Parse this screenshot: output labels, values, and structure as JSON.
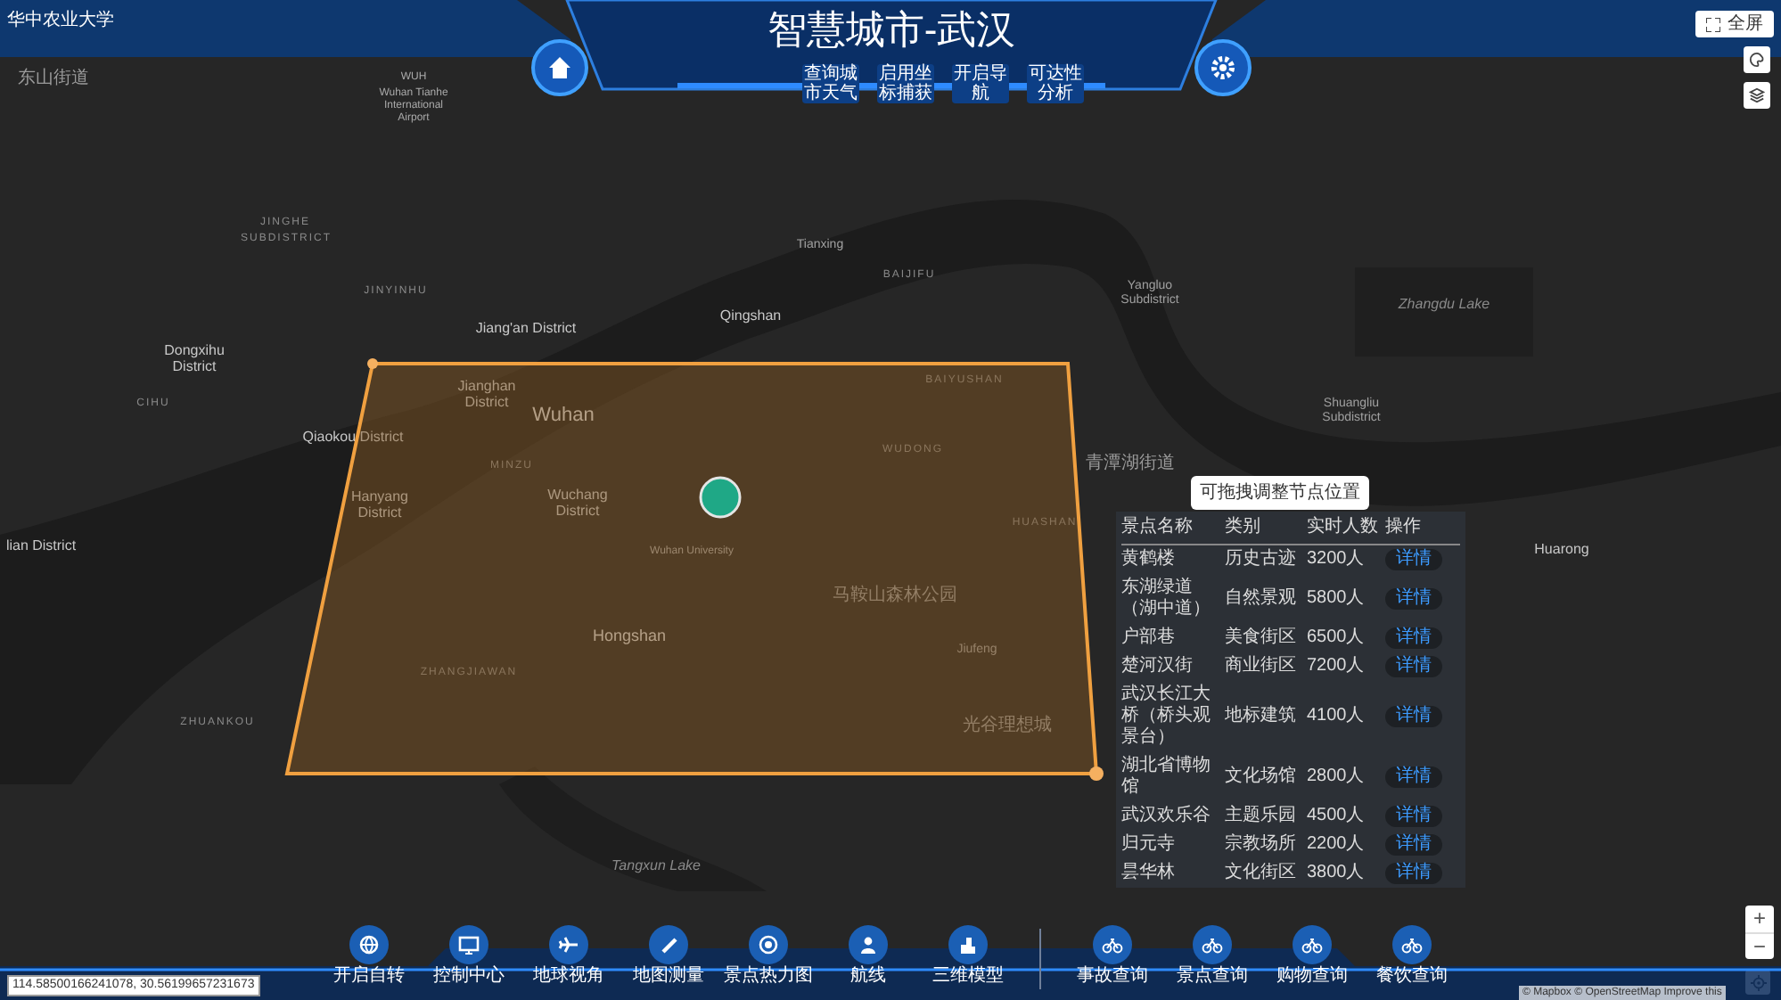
{
  "header": {
    "logo": "华中农业大学",
    "title": "智慧城市-武汉",
    "buttons": [
      "查询城市天气",
      "启用坐标捕获",
      "开启导航",
      "可达性分析"
    ]
  },
  "map_controls": {
    "fullscreen": "全屏",
    "zoom_in": "+",
    "zoom_out": "−"
  },
  "map_labels": [
    "东山街道",
    "WUH",
    "Wuhan Tianhe International Airport",
    "JINGHE SUBDISTRICT",
    "JINYINHU",
    "Tianxing",
    "BAIJIFU",
    "Yangluo Subdistrict",
    "Zhangdu Lake",
    "Qingshan",
    "Jiang'an District",
    "Dongxihu District",
    "CIHU",
    "BAIYUSHAN",
    "Shuangliu Subdistrict",
    "Jianghan District",
    "Wuhan",
    "Qiaokou District",
    "WUDONG",
    "青潭湖街道",
    "MINZU",
    "Hanyang District",
    "Wuchang District",
    "HUASHAN",
    "lian District",
    "Wuhan University",
    "Huarong",
    "马鞍山森林公园",
    "Hongshan",
    "Jiufeng",
    "ZHANGJIAWAN",
    "ZHUANKOU",
    "光谷理想城",
    "Tangxun Lake"
  ],
  "draw_tool": {
    "tooltip": "可拖拽调整节点位置"
  },
  "attractions_table": {
    "columns": [
      "景点名称",
      "类别",
      "实时人数",
      "操作"
    ],
    "rows": [
      {
        "name": "黄鹤楼",
        "category": "历史古迹",
        "visitors": "3200人",
        "action": "详情"
      },
      {
        "name": "东湖绿道（湖中道）",
        "category": "自然景观",
        "visitors": "5800人",
        "action": "详情"
      },
      {
        "name": "户部巷",
        "category": "美食街区",
        "visitors": "6500人",
        "action": "详情"
      },
      {
        "name": "楚河汉街",
        "category": "商业街区",
        "visitors": "7200人",
        "action": "详情"
      },
      {
        "name": "武汉长江大桥（桥头观景台）",
        "category": "地标建筑",
        "visitors": "4100人",
        "action": "详情"
      },
      {
        "name": "湖北省博物馆",
        "category": "文化场馆",
        "visitors": "2800人",
        "action": "详情"
      },
      {
        "name": "武汉欢乐谷",
        "category": "主题乐园",
        "visitors": "4500人",
        "action": "详情"
      },
      {
        "name": "归元寺",
        "category": "宗教场所",
        "visitors": "2200人",
        "action": "详情"
      },
      {
        "name": "昙华林",
        "category": "文化街区",
        "visitors": "3800人",
        "action": "详情"
      }
    ]
  },
  "toolbar": {
    "groups": [
      [
        "开启自转",
        "控制中心",
        "地球视角",
        "地图测量",
        "景点热力图",
        "航线",
        "三维模型"
      ],
      [
        "事故查询",
        "景点查询",
        "购物查询",
        "餐饮查询"
      ]
    ]
  },
  "coordinates": "114.58500166241078, 30.56199657231673",
  "attribution": "© Mapbox © OpenStreetMap Improve this"
}
